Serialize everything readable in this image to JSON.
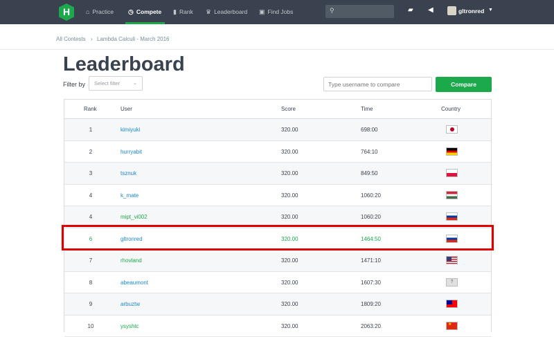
{
  "nav": {
    "logo": "H",
    "items": [
      {
        "label": "Practice",
        "icon": "home-icon"
      },
      {
        "label": "Compete",
        "icon": "clock-icon"
      },
      {
        "label": "Rank",
        "icon": "rank-icon"
      },
      {
        "label": "Leaderboard",
        "icon": "trophy-icon"
      },
      {
        "label": "Find Jobs",
        "icon": "briefcase-icon"
      }
    ],
    "active": "Compete",
    "username": "gltronred"
  },
  "breadcrumb": [
    "All Contests",
    "Lambda Calculi - March 2016"
  ],
  "page_title": "Leaderboard",
  "filter": {
    "label": "Filter by",
    "placeholder": "Select filter"
  },
  "compare": {
    "placeholder": "Type username to compare",
    "button": "Compare"
  },
  "table": {
    "headers": [
      "Rank",
      "User",
      "Score",
      "Time",
      "Country"
    ],
    "rows": [
      {
        "rank": "1",
        "user": "kimiyuki",
        "score": "320.00",
        "time": "698:00",
        "country": "Japan"
      },
      {
        "rank": "2",
        "user": "hurryabit",
        "score": "320.00",
        "time": "764:10",
        "country": "Germany"
      },
      {
        "rank": "3",
        "user": "tsznuk",
        "score": "320.00",
        "time": "849:50",
        "country": "Poland"
      },
      {
        "rank": "4",
        "user": "k_mate",
        "score": "320.00",
        "time": "1060:20",
        "country": "Hungary"
      },
      {
        "rank": "4",
        "user": "mipt_vi002",
        "score": "320.00",
        "time": "1060:20",
        "country": "Russia"
      },
      {
        "rank": "6",
        "user": "gltronred",
        "score": "320.00",
        "time": "1464:50",
        "country": "Russia"
      },
      {
        "rank": "7",
        "user": "rhovland",
        "score": "320.00",
        "time": "1471:10",
        "country": "United States"
      },
      {
        "rank": "8",
        "user": "abeaumont",
        "score": "320.00",
        "time": "1607:30",
        "country": "Unknown"
      },
      {
        "rank": "9",
        "user": "arbuztw",
        "score": "320.00",
        "time": "1809:20",
        "country": "Taiwan"
      },
      {
        "rank": "10",
        "user": "ysyshtc",
        "score": "320.00",
        "time": "2063:20",
        "country": "China"
      }
    ]
  },
  "colors": {
    "brand": "#1ba94c",
    "link": "#1a89c9",
    "highlight": "#e00000",
    "nav_bg": "#39424e"
  }
}
